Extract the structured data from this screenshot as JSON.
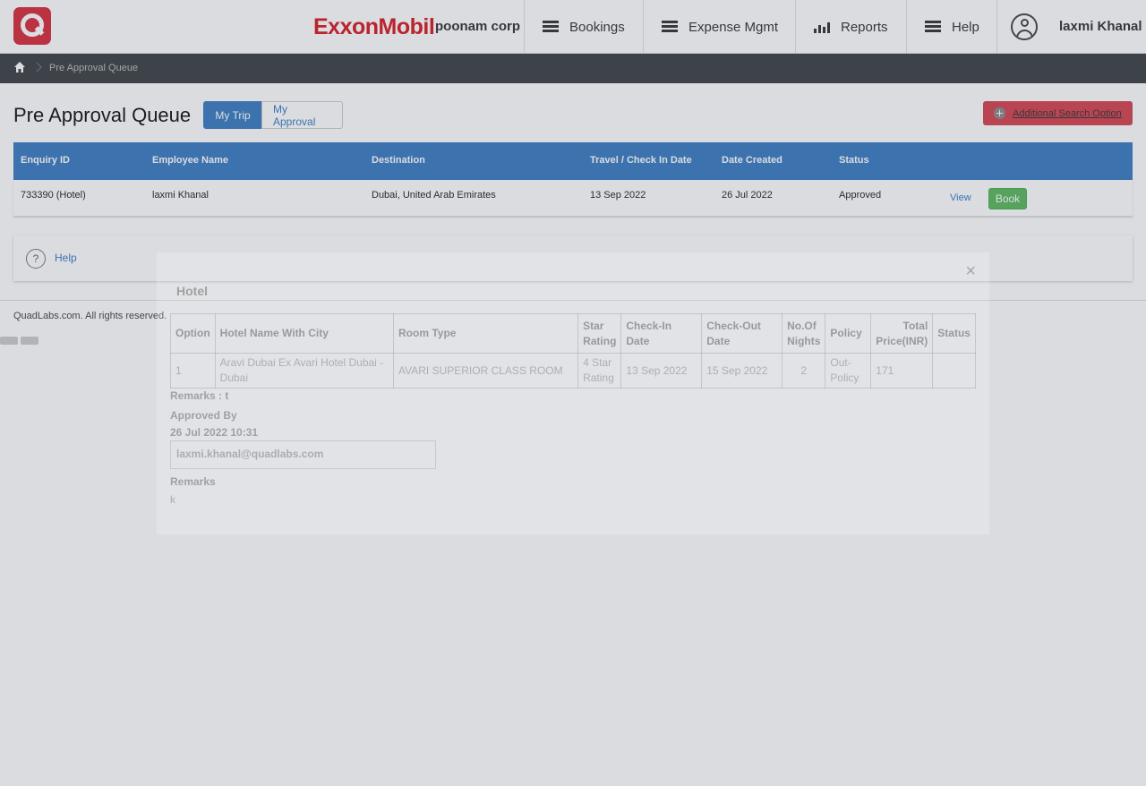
{
  "header": {
    "brand": "ExxonMobil",
    "company": "poonam corp",
    "nav": [
      {
        "label": "Bookings",
        "icon": "menu-icon"
      },
      {
        "label": "Expense Mgmt",
        "icon": "menu-icon"
      },
      {
        "label": "Reports",
        "icon": "bar-chart-icon"
      },
      {
        "label": "Help",
        "icon": "menu-icon"
      }
    ],
    "user_name": "laxmi Khanal"
  },
  "breadcrumb": {
    "current": "Pre Approval Queue"
  },
  "page": {
    "title": "Pre Approval Queue",
    "tabs": [
      {
        "label": "My Trip",
        "active": true
      },
      {
        "label": "My Approval",
        "active": false
      }
    ],
    "additional_search_label": "Additional Search Option"
  },
  "queue_table": {
    "columns": [
      "Enquiry ID",
      "Employee Name",
      "Destination",
      "Travel / Check In Date",
      "Date Created",
      "Status"
    ],
    "rows": [
      {
        "enquiry_id": "733390 (Hotel)",
        "employee": "laxmi Khanal",
        "destination": "Dubai, United Arab Emirates",
        "travel_date": "13 Sep 2022",
        "created": "26 Jul 2022",
        "status": "Approved",
        "view_label": "View",
        "book_label": "Book"
      }
    ]
  },
  "help": {
    "label": "Help",
    "icon_text": "?"
  },
  "footer": {
    "text": "QuadLabs.com. All rights reserved."
  },
  "modal": {
    "close_glyph": "×",
    "title": "Hotel",
    "columns": [
      "Option",
      "Hotel Name With City",
      "Room Type",
      "Star Rating",
      "Check-In Date",
      "Check-Out Date",
      "No.Of Nights",
      "Policy",
      "Total Price(INR)",
      "Status"
    ],
    "row": {
      "option": "1",
      "hotel": "Aravi Dubai Ex Avari Hotel Dubai - Dubai",
      "room_type": "AVARI SUPERIOR CLASS ROOM",
      "star_rating": "4 Star Rating",
      "check_in": "13 Sep 2022",
      "check_out": "15 Sep 2022",
      "nights": "2",
      "policy": "Out-Policy",
      "price": "171",
      "status": ""
    },
    "remarks_line": "Remarks : t",
    "approved_by_label": "Approved By",
    "approved_at": "26 Jul 2022 10:31",
    "approver_email": "laxmi.khanal@quadlabs.com",
    "remarks_label": "Remarks",
    "remarks_value": "k"
  },
  "colors": {
    "brand_red": "#d71920",
    "primary_blue": "#3a7bc0",
    "book_green": "#5cb85c",
    "search_red": "#d8434e",
    "crumb_bar": "#3d4044"
  }
}
